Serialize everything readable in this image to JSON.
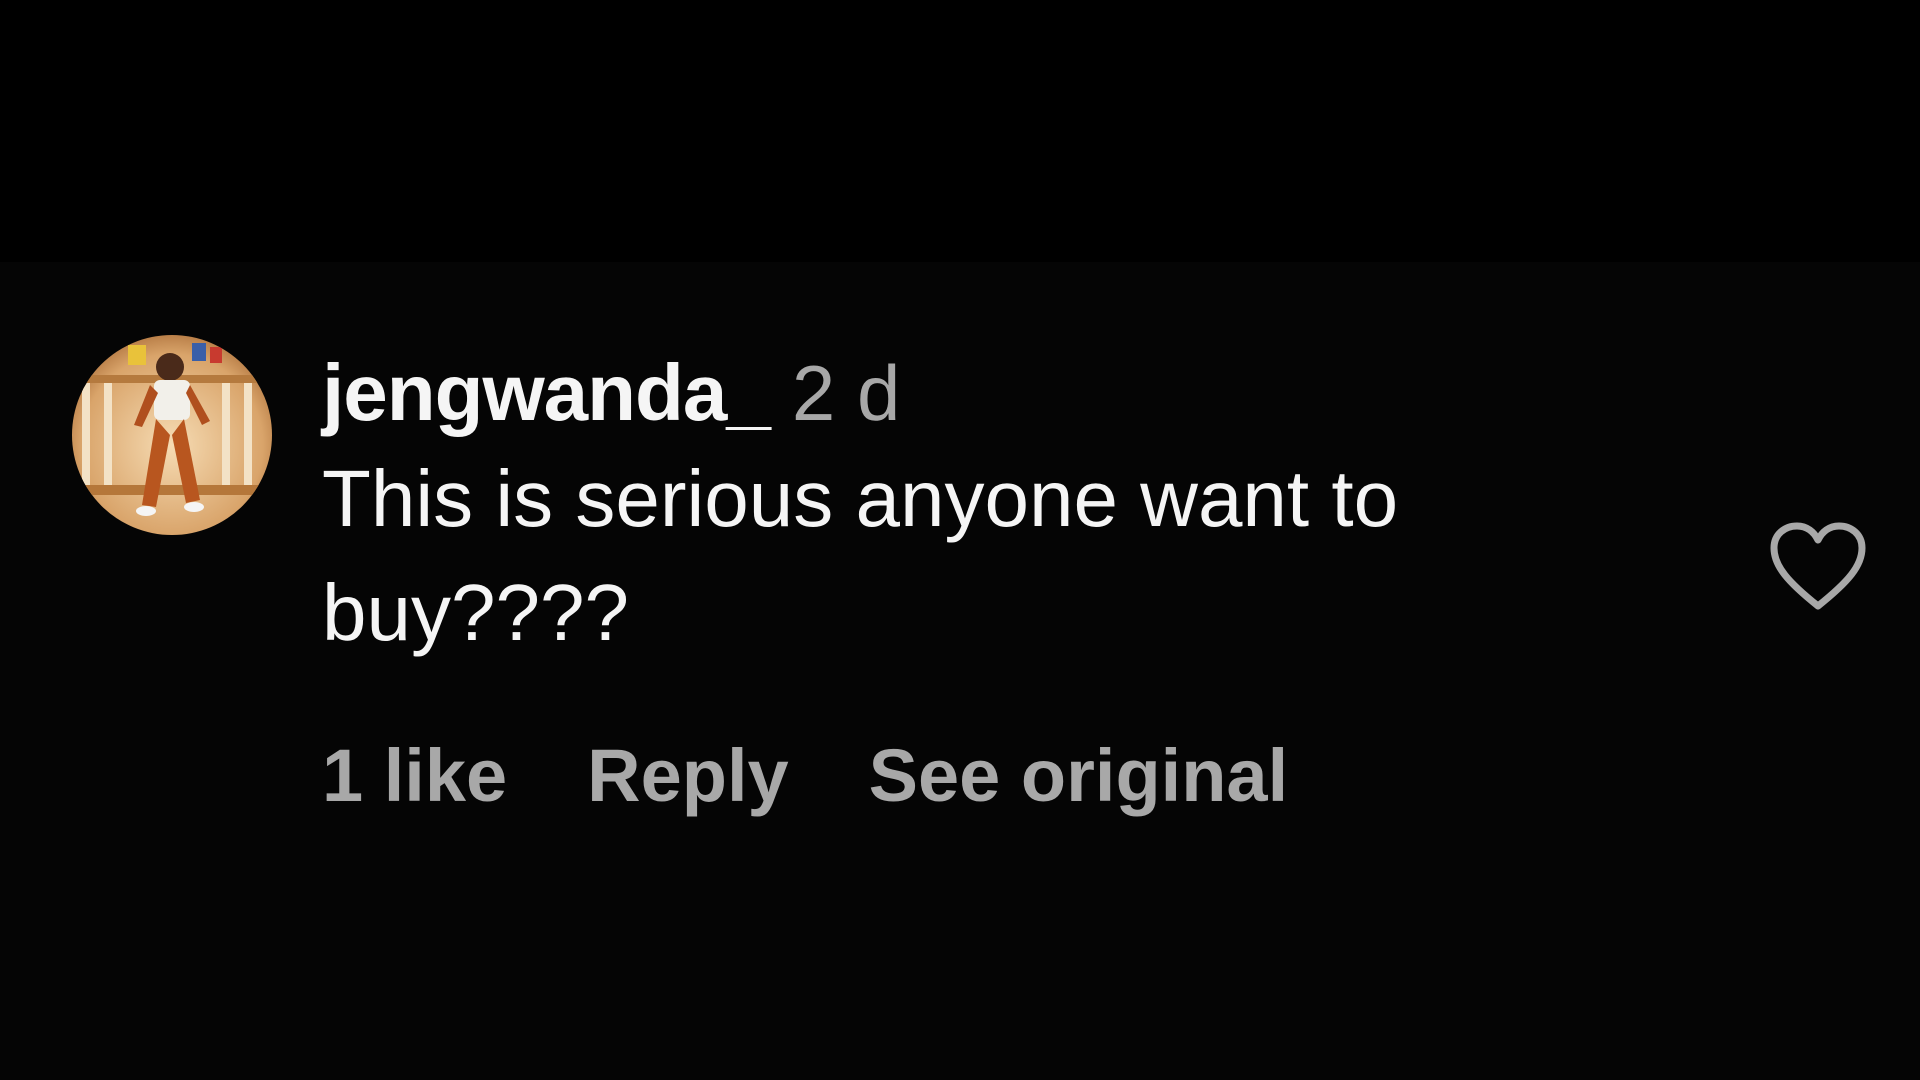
{
  "comment": {
    "username": "jengwanda_",
    "timestamp": "2 d",
    "text": "This is serious anyone want to buy????",
    "avatar_icon": "user-avatar-photo"
  },
  "actions": {
    "likes_label": "1 like",
    "reply_label": "Reply",
    "see_original_label": "See original"
  },
  "like_button": {
    "icon": "heart-outline-icon"
  },
  "colors": {
    "background": "#000000",
    "primary_text": "#f5f5f5",
    "secondary_text": "#a8a8a8"
  }
}
